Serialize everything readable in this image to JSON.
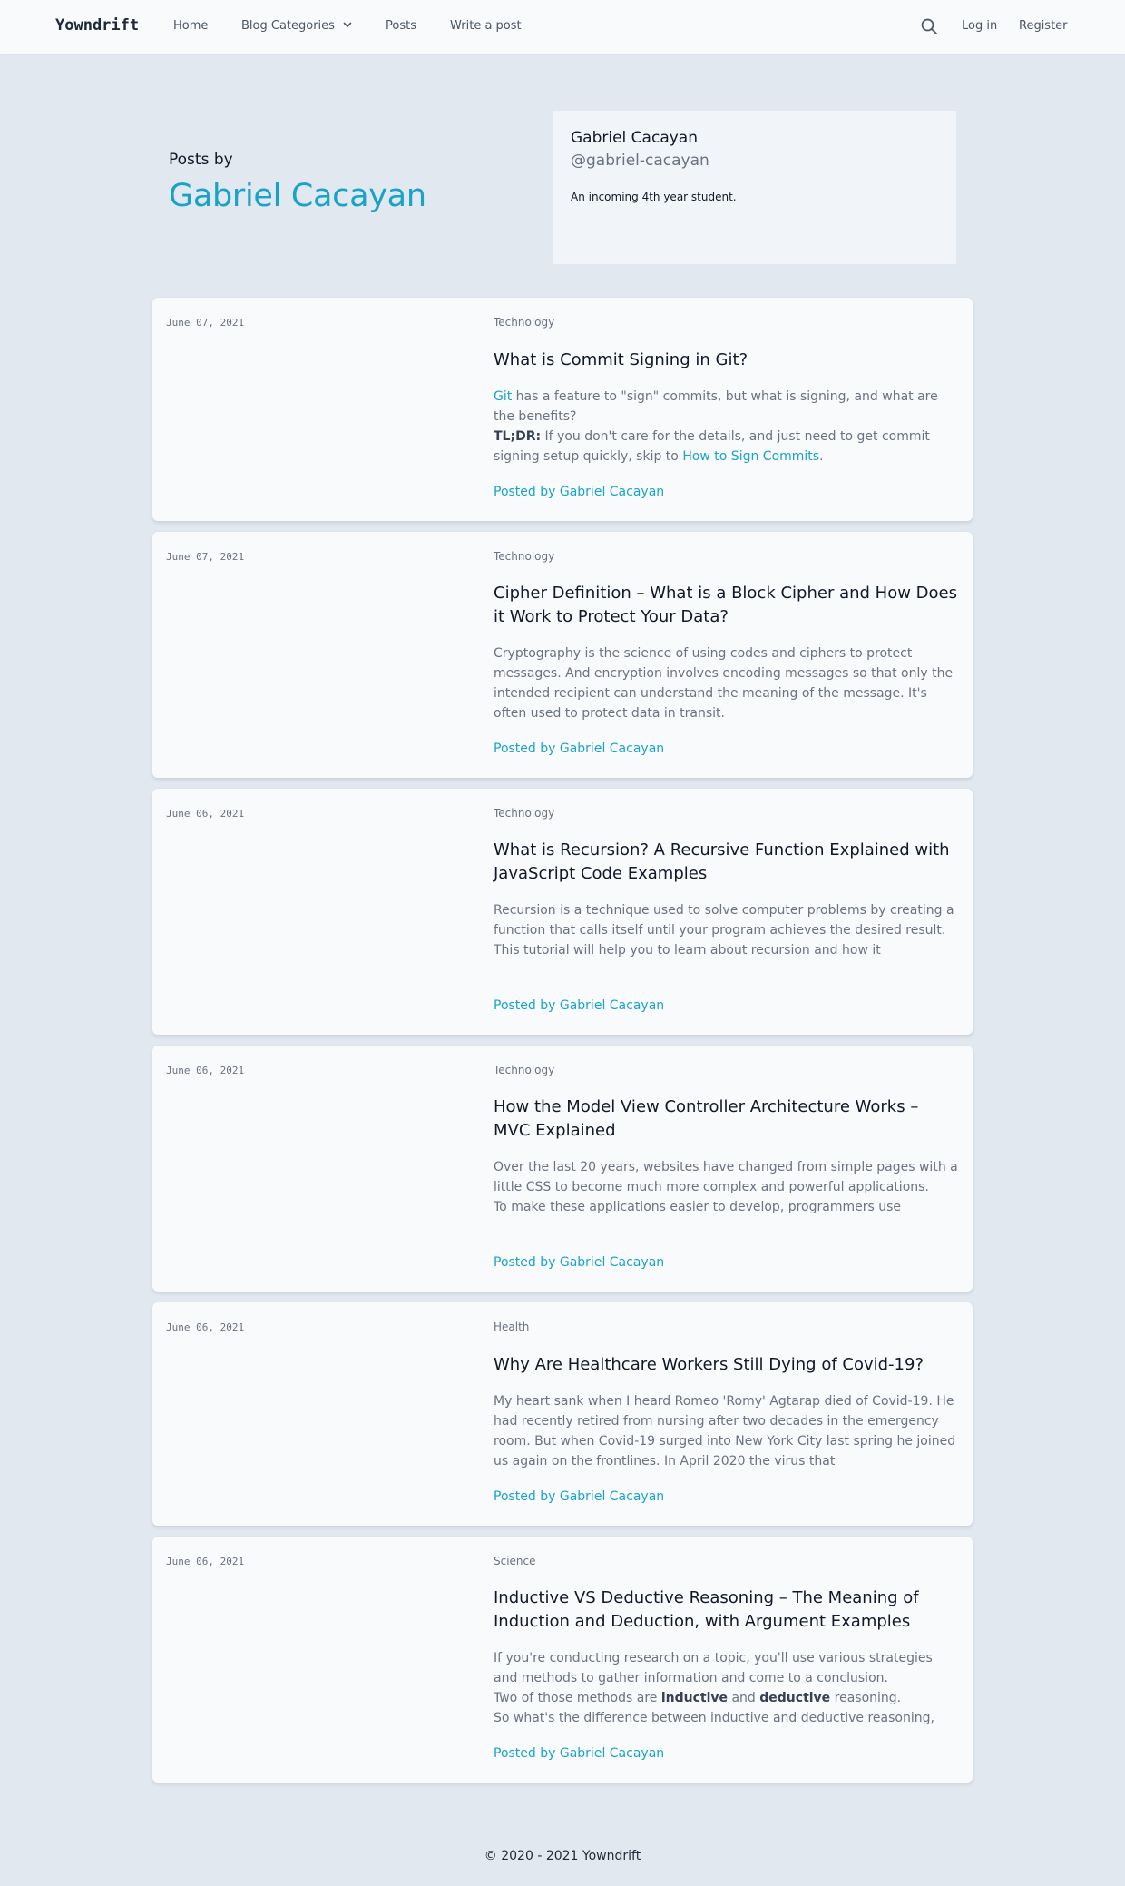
{
  "nav": {
    "brand": "Yowndrift",
    "home": "Home",
    "categories": "Blog Categories",
    "posts": "Posts",
    "write": "Write a post",
    "login": "Log in",
    "register": "Register"
  },
  "header": {
    "posts_by": "Posts by",
    "author": "Gabriel Cacayan"
  },
  "profile": {
    "name": "Gabriel Cacayan",
    "handle": "@gabriel-cacayan",
    "bio": "An incoming 4th year student."
  },
  "posts": [
    {
      "date": "June 07, 2021",
      "category": "Technology",
      "title": "What is Commit Signing in Git?",
      "excerpt_link1": "Git",
      "excerpt_a": " has a feature to \"sign\" commits, but what is signing, and what are the benefits?",
      "excerpt_bold": "TL;DR:",
      "excerpt_b": " If you don't care for the details, and just need to get commit signing setup quickly, skip to ",
      "excerpt_link2": "How to Sign Commits",
      "excerpt_c": ".",
      "posted_by": "Posted by Gabriel Cacayan"
    },
    {
      "date": "June 07, 2021",
      "category": "Technology",
      "title": "Cipher Definition – What is a Block Cipher and How Does it Work to Protect Your Data?",
      "excerpt": "Cryptography is the science of using codes and ciphers to protect messages. And encryption involves encoding messages so that only the intended recipient can understand the meaning of the message. It's often used to protect data in transit.",
      "posted_by": "Posted by Gabriel Cacayan"
    },
    {
      "date": "June 06, 2021",
      "category": "Technology",
      "title": "What is Recursion? A Recursive Function Explained with JavaScript Code Examples",
      "excerpt_line1": "Recursion is a technique used to solve computer problems by creating a function that calls itself until your program achieves the desired result.",
      "excerpt_line2": "This tutorial will help you to learn about recursion and how it",
      "posted_by": "Posted by Gabriel Cacayan"
    },
    {
      "date": "June 06, 2021",
      "category": "Technology",
      "title": "How the Model View Controller Architecture Works – MVC Explained",
      "excerpt_line1": "Over the last 20 years, websites have changed from simple pages with a little CSS to become much more complex and powerful applications.",
      "excerpt_line2": "To make these applications easier to develop, programmers use",
      "posted_by": "Posted by Gabriel Cacayan"
    },
    {
      "date": "June 06, 2021",
      "category": "Health",
      "title": "Why Are Healthcare Workers Still Dying of Covid-19?",
      "excerpt": "My heart sank when I heard Romeo 'Romy' Agtarap died of Covid-19. He had recently retired from nursing after two decades in the emergency room. But when Covid-19 surged into New York City last spring he joined us again on the frontlines. In April 2020 the virus that",
      "posted_by": "Posted by Gabriel Cacayan"
    },
    {
      "date": "June 06, 2021",
      "category": "Science",
      "title": "Inductive VS Deductive Reasoning – The Meaning of Induction and Deduction, with Argument Examples",
      "excerpt_line1": "If you're conducting research on a topic, you'll use various strategies and methods to gather information and come to a conclusion.",
      "excerpt_a": "Two of those methods are ",
      "excerpt_bold1": "inductive",
      "excerpt_b": " and ",
      "excerpt_bold2": "deductive",
      "excerpt_c": " reasoning.",
      "excerpt_line3": "So what's the difference between inductive and deductive reasoning,",
      "posted_by": "Posted by Gabriel Cacayan"
    }
  ],
  "footer": "© 2020 - 2021 Yowndrift"
}
